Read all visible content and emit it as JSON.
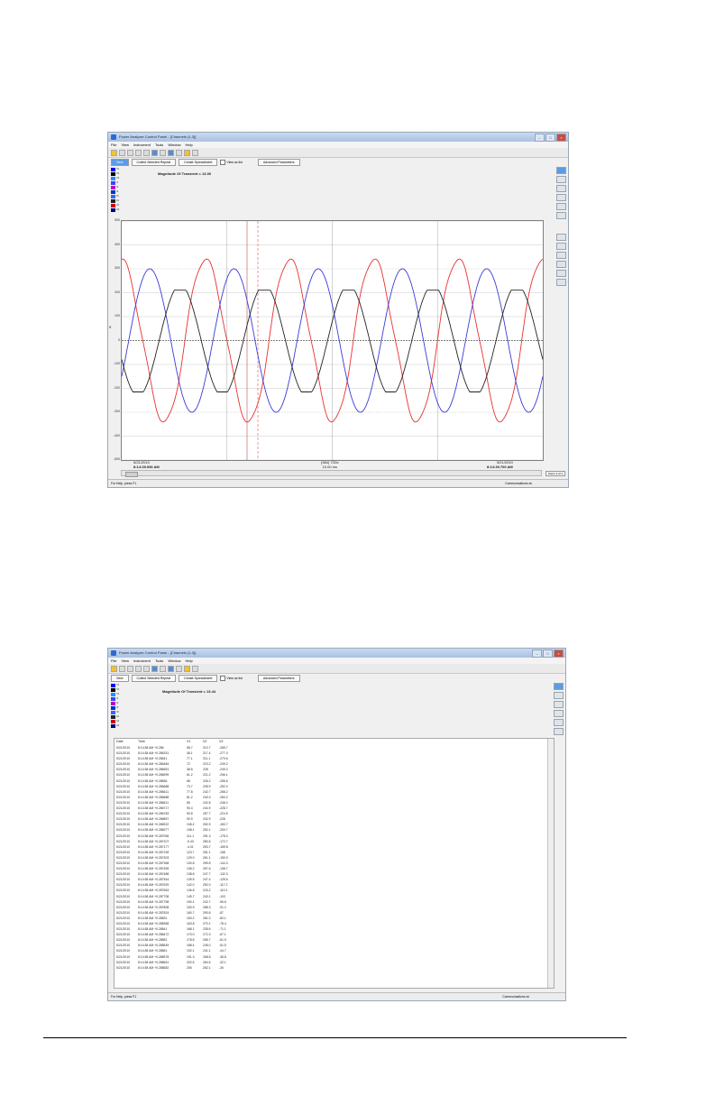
{
  "window": {
    "title": "Power Analyzer Control Panel - [Channels (1-3)]",
    "menu": [
      "File",
      "View",
      "Instrument",
      "Tools",
      "Window",
      "Help"
    ]
  },
  "tabs": {
    "view": "View",
    "collect_selected": "Collect Selected Repeat",
    "create_spreadsheet": "Create Spreadsheet",
    "view_as_list": "View as list",
    "advanced": "Advanced Parameters"
  },
  "legend_channels": [
    {
      "label": "V1",
      "color": "#0000ff"
    },
    {
      "label": "V2",
      "color": "#000000"
    },
    {
      "label": "V3",
      "color": "#1e90ff"
    },
    {
      "label": "I1",
      "color": "#4040ff"
    },
    {
      "label": "I2",
      "color": "#c000c0"
    },
    {
      "label": "I3",
      "color": "#0033cc"
    },
    {
      "label": "IN",
      "color": "#3366ff"
    },
    {
      "label": "A1",
      "color": "#222222"
    },
    {
      "label": "A2",
      "color": "#d00000"
    },
    {
      "label": "A3",
      "color": "#000080"
    }
  ],
  "waveform_panel": {
    "magnitude_label": "Magnitude Of Transient = 13.00",
    "y_ticks": [
      "500",
      "400",
      "300",
      "200",
      "100",
      "0",
      "-100",
      "-200",
      "-300",
      "-400",
      "-500"
    ],
    "y_axis_label": "V",
    "time_left_date": "5/21/2010",
    "time_left_time": "8:14:39.536 AM",
    "time_mid_line1": "(984) 7/Div",
    "time_mid_line2": "10.00 ms",
    "time_right_date": "5/21/2010",
    "time_right_time": "8:14:39.700 AM",
    "status_left": "For Help, press F1",
    "status_right": "Communications ok",
    "zoom_label": "Zoom 1 of 1"
  },
  "chart_data": {
    "type": "line",
    "ylim": [
      -500,
      500
    ],
    "grid": true,
    "x_unit": "ms",
    "x_range": [
      0,
      100
    ],
    "series": [
      {
        "color": "#e83030",
        "amplitude": 340,
        "period_ms": 20,
        "phase_deg": 90,
        "notes": "distorted peaks"
      },
      {
        "color": "#3a3ad8",
        "amplitude": 300,
        "period_ms": 20,
        "phase_deg": -30
      },
      {
        "color": "#222222",
        "amplitude": 215,
        "period_ms": 20,
        "phase_deg": 200,
        "notes": "flattened top with steps"
      }
    ]
  },
  "list_panel": {
    "magnitude_label": "Magnitude Of Transient = 13.44",
    "columns": [
      "Date",
      "Time",
      "V1",
      "V2",
      "V3"
    ],
    "rows": [
      [
        "5/21/2010",
        "8:14:38 AM +0.286",
        "58.7",
        "210.7",
        "-265.7"
      ],
      [
        "5/21/2010",
        "8:14:38 AM +0.286331",
        "48.1",
        "217.4",
        "-277.0"
      ],
      [
        "5/21/2010",
        "8:14:38 AM +0.28641",
        "77.1",
        "211.1",
        "-270.6"
      ],
      [
        "5/21/2010",
        "8:14:38 AM +0.286484",
        "72",
        "223.2",
        "-249.2"
      ],
      [
        "5/21/2010",
        "8:14:38 AM +0.286551",
        "38.8",
        "228",
        "-249.2"
      ],
      [
        "5/21/2010",
        "8:14:38 AM +0.286599",
        "61.2",
        "221.2",
        "-256.1"
      ],
      [
        "5/21/2010",
        "8:14:38 AM +0.28656",
        "68",
        "226.2",
        "-255.6"
      ],
      [
        "5/21/2010",
        "8:14:38 AM +0.286688",
        "73.7",
        "235.9",
        "-252.0"
      ],
      [
        "5/21/2010",
        "8:14:38 AM +0.286611",
        "77.8",
        "242.7",
        "-268.2"
      ],
      [
        "5/21/2010",
        "8:14:38 AM +0.286688",
        "81.2",
        "243.3",
        "-283.2"
      ],
      [
        "5/21/2010",
        "8:14:38 AM +0.286611",
        "85",
        "242.8",
        "-248.2"
      ],
      [
        "5/21/2010",
        "8:14:38 AM +0.286717",
        "90.4",
        "244.9",
        "-228.7"
      ],
      [
        "5/21/2010",
        "8:14:38 AM +0.286783",
        "90.8",
        "257.7",
        "-224.5"
      ],
      [
        "5/21/2010",
        "8:14:38 AM +0.286857",
        "90.9",
        "232.9",
        "-228"
      ],
      [
        "5/21/2010",
        "8:14:38 AM +0.286922",
        "108.2",
        "252.9",
        "-183.7"
      ],
      [
        "5/21/2010",
        "8:14:38 AM +0.286977",
        "108.1",
        "252.1",
        "-200.7"
      ],
      [
        "5/21/2010",
        "8:14:38 AM +0.287056",
        "111.1",
        "251.3",
        "-178.0"
      ],
      [
        "5/21/2010",
        "8:14:38 AM +0.287107",
        "-9.43",
        "280.8",
        "-172.7"
      ],
      [
        "5/21/2010",
        "8:14:38 AM +0.287177",
        "-4.01",
        "253.7",
        "-169.8"
      ],
      [
        "5/21/2010",
        "8:14:38 AM +0.287228",
        "123.7",
        "251.1",
        "-158"
      ],
      [
        "5/21/2010",
        "8:14:38 AM +0.287303",
        "129.0",
        "261.1",
        "-150.9"
      ],
      [
        "5/21/2010",
        "8:14:38 AM +0.287368",
        "130.8",
        "259.8",
        "-144.3"
      ],
      [
        "5/21/2010",
        "8:14:38 AM +0.287455",
        "136.2",
        "257.6",
        "-138.7"
      ],
      [
        "5/21/2010",
        "8:14:38 AM +0.287488",
        "138.8",
        "247.7",
        "-132.3"
      ],
      [
        "5/21/2010",
        "8:14:38 AM +0.287544",
        "139.5",
        "247.4",
        "-125.6"
      ],
      [
        "5/21/2010",
        "8:14:38 AM +0.287629",
        "142.0",
        "252.0",
        "-117.2"
      ],
      [
        "5/21/2010",
        "8:14:38 AM +0.287663",
        "146.8",
        "243.2",
        "-110.1"
      ],
      [
        "5/21/2010",
        "8:14:38 AM +0.287708",
        "149.7",
        "243.1",
        "-103"
      ],
      [
        "5/21/2010",
        "8:14:38 AM +0.287758",
        "150.1",
        "242.7",
        "-96.6"
      ],
      [
        "5/21/2010",
        "8:14:38 AM +0.287808",
        "153.9",
        "288.3",
        "-91.2"
      ],
      [
        "5/21/2010",
        "8:14:38 AM +0.287824",
        "160.7",
        "290.8",
        "-87"
      ],
      [
        "5/21/2010",
        "8:14:38 AM +0.28831",
        "163.2",
        "281.0",
        "-80.1"
      ],
      [
        "5/21/2010",
        "8:14:38 AM +0.288358",
        "163.8",
        "270.1",
        "-78.4"
      ],
      [
        "5/21/2010",
        "8:14:38 AM +0.28841",
        "168.1",
        "235.6",
        "-71.1"
      ],
      [
        "5/21/2010",
        "8:14:38 AM +0.288472",
        "170.0",
        "272.3",
        "-67.1"
      ],
      [
        "5/21/2010",
        "8:14:38 AM +0.28852",
        "178.8",
        "265.7",
        "-61.9"
      ],
      [
        "5/21/2010",
        "8:14:38 AM +0.288549",
        "188.4",
        "245.0",
        "-51.5"
      ],
      [
        "5/21/2010",
        "8:14:38 AM +0.28861",
        "192.1",
        "241.1",
        "-44.7"
      ],
      [
        "5/21/2010",
        "8:14:38 AM +0.288578",
        "191.3",
        "268.8",
        "-38.8"
      ],
      [
        "5/21/2010",
        "8:14:38 AM +0.288651",
        "202.6",
        "264.6",
        "-32.1"
      ],
      [
        "5/21/2010",
        "8:14:38 AM +0.288682",
        "206",
        "262.1",
        "-26"
      ]
    ],
    "status_left": "For Help, press F1",
    "status_right": "Communications ok"
  }
}
